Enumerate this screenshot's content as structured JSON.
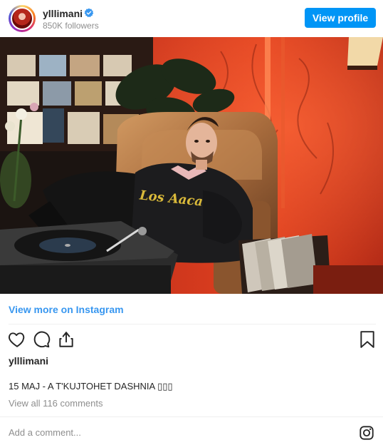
{
  "header": {
    "username": "ylllimani",
    "followers": "850K followers",
    "view_profile_label": "View profile"
  },
  "post": {
    "view_more_label": "View more on Instagram",
    "likes_user": "ylllimani",
    "caption": "15 MAJ - A T'KUJTOHET DASHNIA ▯▯▯",
    "comments_link": "View all 116 comments"
  },
  "footer": {
    "add_comment_placeholder": "Add a comment..."
  },
  "photo": {
    "jacket_text": "Los Aaca"
  },
  "icons": {
    "verified": "verified-badge-icon",
    "like": "heart-icon",
    "comment": "comment-bubble-icon",
    "share": "share-icon",
    "save": "bookmark-icon",
    "instagram": "instagram-logo-icon"
  },
  "colors": {
    "accent": "#0095f6",
    "link": "#3897f0",
    "muted": "#8e8e8e",
    "text": "#262626"
  }
}
